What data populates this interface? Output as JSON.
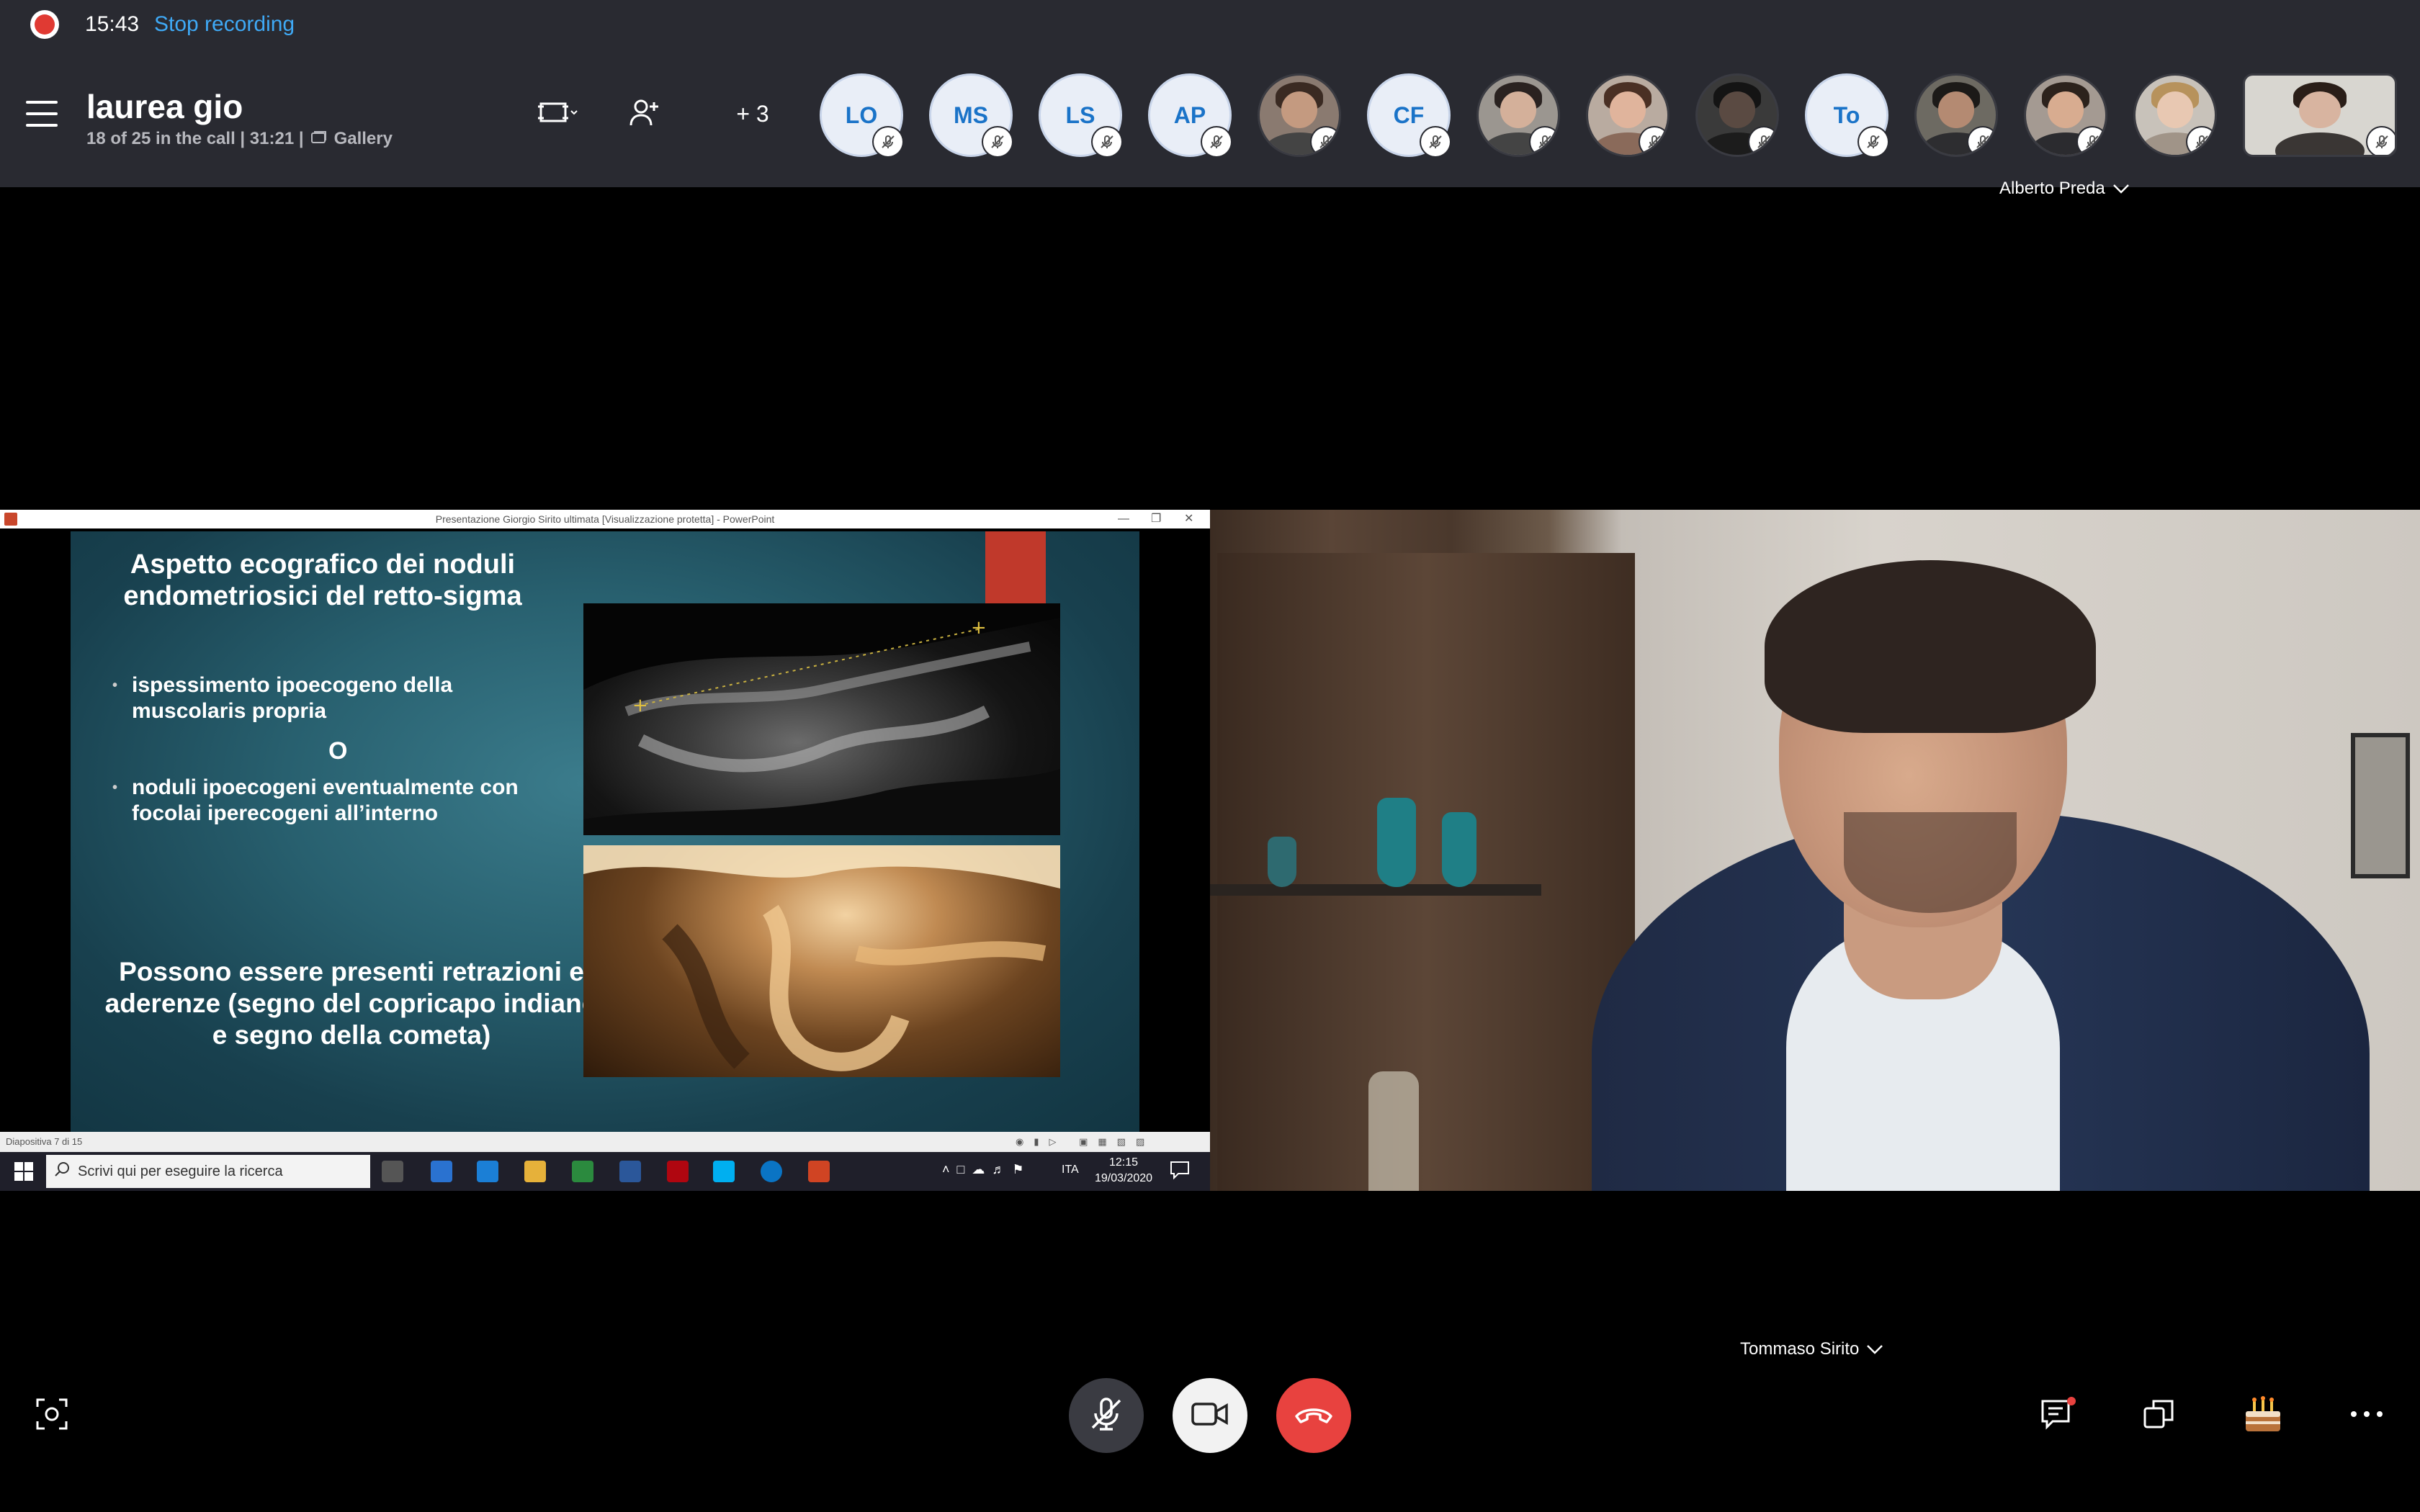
{
  "recording": {
    "time": "15:43",
    "stop_label": "Stop recording"
  },
  "call": {
    "title": "laurea gio",
    "participants_info": "18 of 25 in the call | 31:21 |",
    "view_mode": "Gallery",
    "more_participants": "+ 3"
  },
  "participants": [
    {
      "initials": "LO",
      "type": "initials"
    },
    {
      "initials": "MS",
      "type": "initials"
    },
    {
      "initials": "LS",
      "type": "initials"
    },
    {
      "initials": "AP",
      "type": "initials"
    },
    {
      "initials": "",
      "type": "photo"
    },
    {
      "initials": "CF",
      "type": "initials"
    },
    {
      "initials": "",
      "type": "photo"
    },
    {
      "initials": "",
      "type": "photo"
    },
    {
      "initials": "",
      "type": "photo"
    },
    {
      "initials": "To",
      "type": "initials"
    },
    {
      "initials": "",
      "type": "photo"
    },
    {
      "initials": "",
      "type": "photo"
    },
    {
      "initials": "",
      "type": "photo"
    },
    {
      "initials": "",
      "type": "photo"
    }
  ],
  "name_tags": {
    "top": "Alberto Preda",
    "speaker": "Tommaso Sirito"
  },
  "powerpoint": {
    "window_title": "Presentazione Giorgio Sirito ultimata [Visualizzazione protetta] - PowerPoint",
    "slide_title": "Aspetto ecografico dei noduli endometriosici del retto-sigma",
    "bullet1": "ispessimento ipoecogeno della muscolaris propria",
    "or_text": "O",
    "bullet2": "noduli ipoecogeni eventualmente con focolai iperecogeni all’interno",
    "footer": "Possono essere presenti retrazioni e aderenze (segno del copricapo indiano e segno della cometa)",
    "slide_number": "Diapositiva 7 di 15"
  },
  "taskbar": {
    "search_placeholder": "Scrivi qui per eseguire la ricerca",
    "language": "ITA",
    "time": "12:15",
    "date": "19/03/2020"
  },
  "colors": {
    "accent": "#3fa9f5",
    "end_call": "#e8423f",
    "record": "#e03a33",
    "topbar": "#292a31"
  }
}
